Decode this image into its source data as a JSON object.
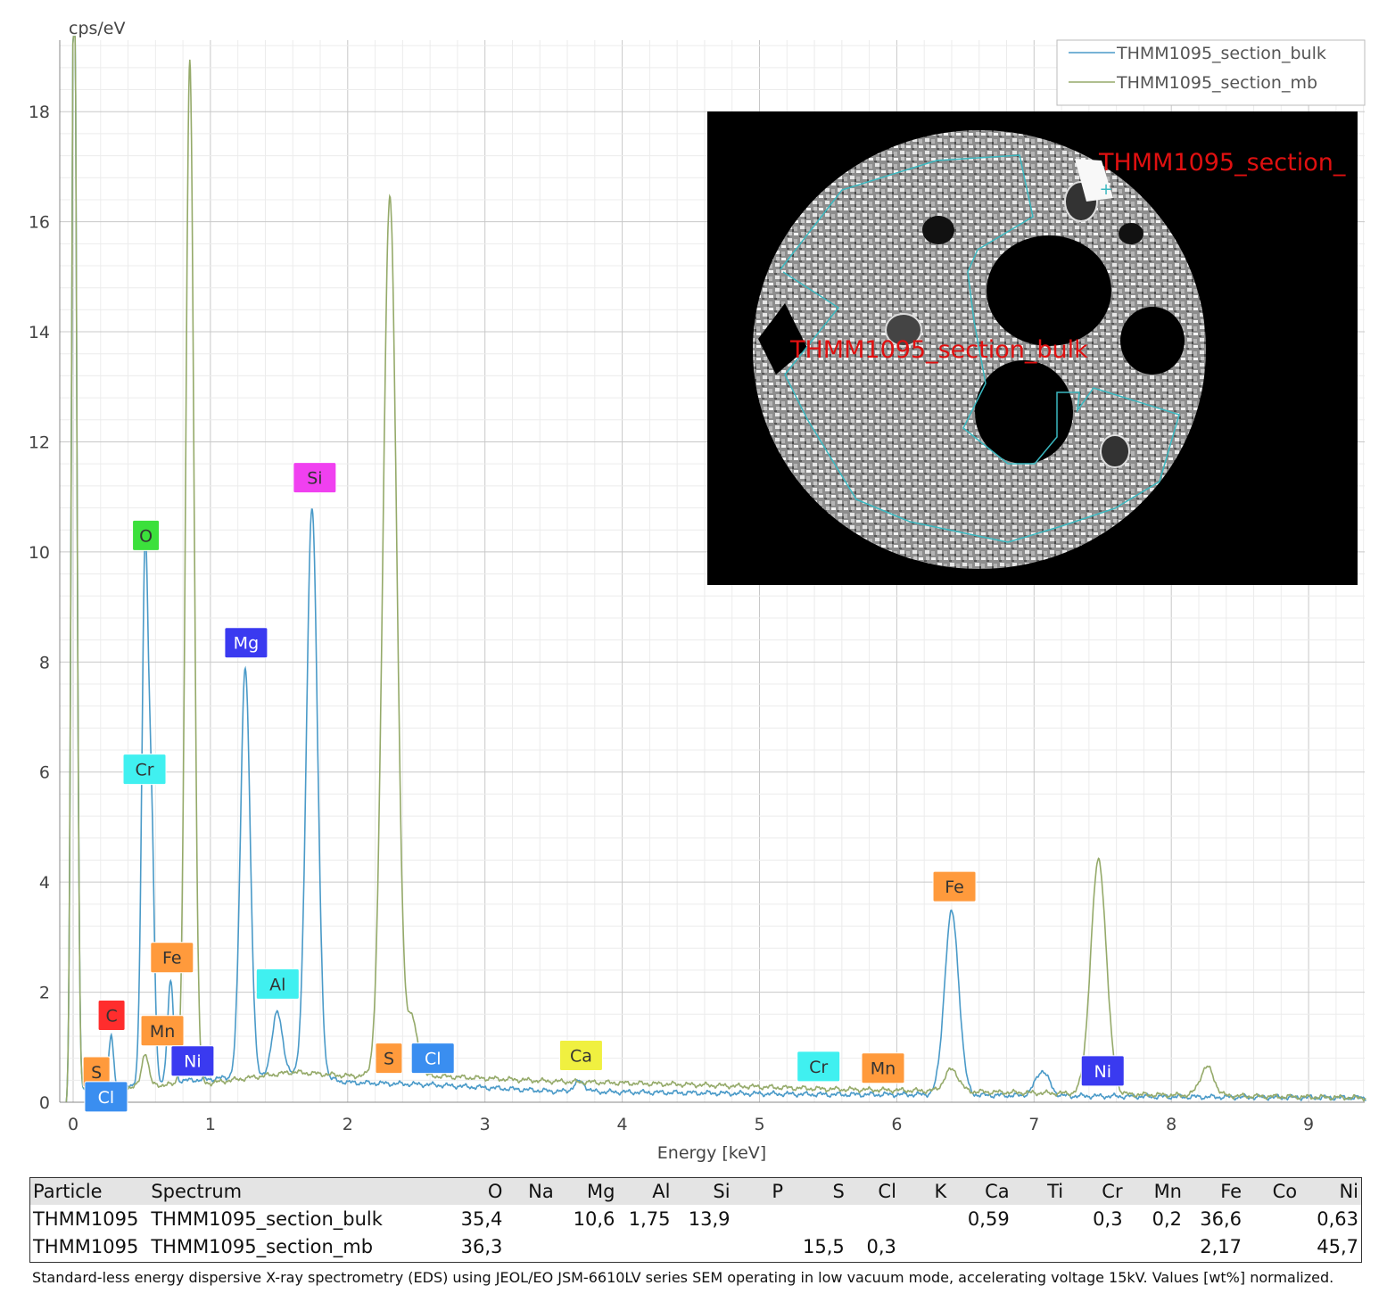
{
  "chart_data": {
    "type": "line",
    "ylabel": "cps/eV",
    "xlabel": "Energy [keV]",
    "xlim": [
      -0.1,
      9.42
    ],
    "ylim": [
      0,
      19.3
    ],
    "x_ticks": [
      "0",
      "1",
      "2",
      "3",
      "4",
      "5",
      "6",
      "7",
      "8",
      "9"
    ],
    "y_ticks": [
      "0",
      "2",
      "4",
      "6",
      "8",
      "10",
      "12",
      "14",
      "16",
      "18"
    ],
    "grid": true,
    "legend_position": "top-right",
    "series": [
      {
        "name": "THMM1095_section_bulk",
        "color": "#4a9ac8",
        "baseline": [
          [
            0.05,
            0.25
          ],
          [
            0.2,
            0.22
          ],
          [
            0.5,
            0.35
          ],
          [
            1.0,
            0.42
          ],
          [
            1.6,
            0.55
          ],
          [
            2.0,
            0.36
          ],
          [
            2.6,
            0.32
          ],
          [
            3.5,
            0.2
          ],
          [
            4.5,
            0.17
          ],
          [
            5.5,
            0.14
          ],
          [
            6.2,
            0.14
          ],
          [
            7.0,
            0.12
          ],
          [
            8.0,
            0.1
          ],
          [
            9.42,
            0.08
          ]
        ],
        "peaks": [
          [
            0.0,
            40,
            0.02
          ],
          [
            0.277,
            0.95,
            0.018
          ],
          [
            0.525,
            9.7,
            0.024
          ],
          [
            0.573,
            4.0,
            0.02
          ],
          [
            0.71,
            1.8,
            0.022
          ],
          [
            1.254,
            7.45,
            0.035
          ],
          [
            1.487,
            1.15,
            0.035
          ],
          [
            1.74,
            10.35,
            0.04
          ],
          [
            3.69,
            0.18,
            0.04
          ],
          [
            6.4,
            3.32,
            0.052
          ],
          [
            7.06,
            0.45,
            0.05
          ]
        ]
      },
      {
        "name": "THMM1095_section_mb",
        "color": "#95aa6a",
        "baseline": [
          [
            0.05,
            0.25
          ],
          [
            0.2,
            0.22
          ],
          [
            0.5,
            0.3
          ],
          [
            1.0,
            0.35
          ],
          [
            1.6,
            0.55
          ],
          [
            2.0,
            0.48
          ],
          [
            2.6,
            0.48
          ],
          [
            3.5,
            0.38
          ],
          [
            4.5,
            0.32
          ],
          [
            5.5,
            0.24
          ],
          [
            6.2,
            0.21
          ],
          [
            7.0,
            0.17
          ],
          [
            8.0,
            0.13
          ],
          [
            9.42,
            0.08
          ]
        ],
        "peaks": [
          [
            0.0,
            40,
            0.02
          ],
          [
            0.525,
            0.6,
            0.024
          ],
          [
            0.85,
            18.6,
            0.03
          ],
          [
            2.307,
            16.0,
            0.05
          ],
          [
            2.47,
            1.0,
            0.04
          ],
          [
            6.4,
            0.4,
            0.05
          ],
          [
            7.47,
            4.25,
            0.057
          ],
          [
            8.26,
            0.52,
            0.05
          ]
        ]
      }
    ],
    "element_labels": [
      {
        "text": "C",
        "x": 0.28,
        "y": 1.58,
        "color": "#ff2d2d"
      },
      {
        "text": "O",
        "x": 0.53,
        "y": 10.3,
        "color": "#3ce03c"
      },
      {
        "text": "Cr",
        "x": 0.52,
        "y": 6.05,
        "color": "#40f0f0"
      },
      {
        "text": "Fe",
        "x": 0.72,
        "y": 2.63,
        "color": "#ff9a3c"
      },
      {
        "text": "Mn",
        "x": 0.65,
        "y": 1.3,
        "color": "#ff9a3c"
      },
      {
        "text": "Ni",
        "x": 0.87,
        "y": 0.75,
        "color": "#3a3af0"
      },
      {
        "text": "S",
        "x": 0.17,
        "y": 0.55,
        "color": "#ff9a3c"
      },
      {
        "text": "Cl",
        "x": 0.24,
        "y": 0.1,
        "color": "#3a8ef0"
      },
      {
        "text": "Mg",
        "x": 1.26,
        "y": 8.35,
        "color": "#3a3af0"
      },
      {
        "text": "Al",
        "x": 1.49,
        "y": 2.15,
        "color": "#40f0f0"
      },
      {
        "text": "Si",
        "x": 1.76,
        "y": 11.35,
        "color": "#f040f0"
      },
      {
        "text": "S",
        "x": 2.3,
        "y": 0.8,
        "color": "#ff9a3c"
      },
      {
        "text": "Cl",
        "x": 2.62,
        "y": 0.8,
        "color": "#3a8ef0"
      },
      {
        "text": "Ca",
        "x": 3.7,
        "y": 0.85,
        "color": "#f0f040"
      },
      {
        "text": "Cr",
        "x": 5.43,
        "y": 0.65,
        "color": "#40f0f0"
      },
      {
        "text": "Mn",
        "x": 5.9,
        "y": 0.62,
        "color": "#ff9a3c"
      },
      {
        "text": "Fe",
        "x": 6.42,
        "y": 3.92,
        "color": "#ff9a3c"
      },
      {
        "text": "Ni",
        "x": 7.5,
        "y": 0.57,
        "color": "#3a3af0"
      }
    ]
  },
  "inset": {
    "labels": [
      "THMM1095_section_",
      "THMM1095_section_bulk"
    ],
    "label_color": "#e01010",
    "outline_color": "#3ab8c0"
  },
  "table": {
    "headers": [
      "Particle",
      "Spectrum",
      "O",
      "Na",
      "Mg",
      "Al",
      "Si",
      "P",
      "S",
      "Cl",
      "K",
      "Ca",
      "Ti",
      "Cr",
      "Mn",
      "Fe",
      "Co",
      "Ni"
    ],
    "rows": [
      [
        "THMM1095",
        "THMM1095_section_bulk",
        "35,4",
        "",
        "10,6",
        "1,75",
        "13,9",
        "",
        "",
        "",
        "",
        "0,59",
        "",
        "0,3",
        "0,2",
        "36,6",
        "",
        "0,63"
      ],
      [
        "THMM1095",
        "THMM1095_section_mb",
        "36,3",
        "",
        "",
        "",
        "",
        "",
        "15,5",
        "0,3",
        "",
        "",
        "",
        "",
        "",
        "2,17",
        "",
        "45,7"
      ]
    ]
  },
  "caption": "Standard-less energy dispersive X-ray spectrometry (EDS) using JEOL/EO JSM-6610LV series SEM operating in low vacuum mode, accelerating voltage 15kV. Values [wt%] normalized."
}
